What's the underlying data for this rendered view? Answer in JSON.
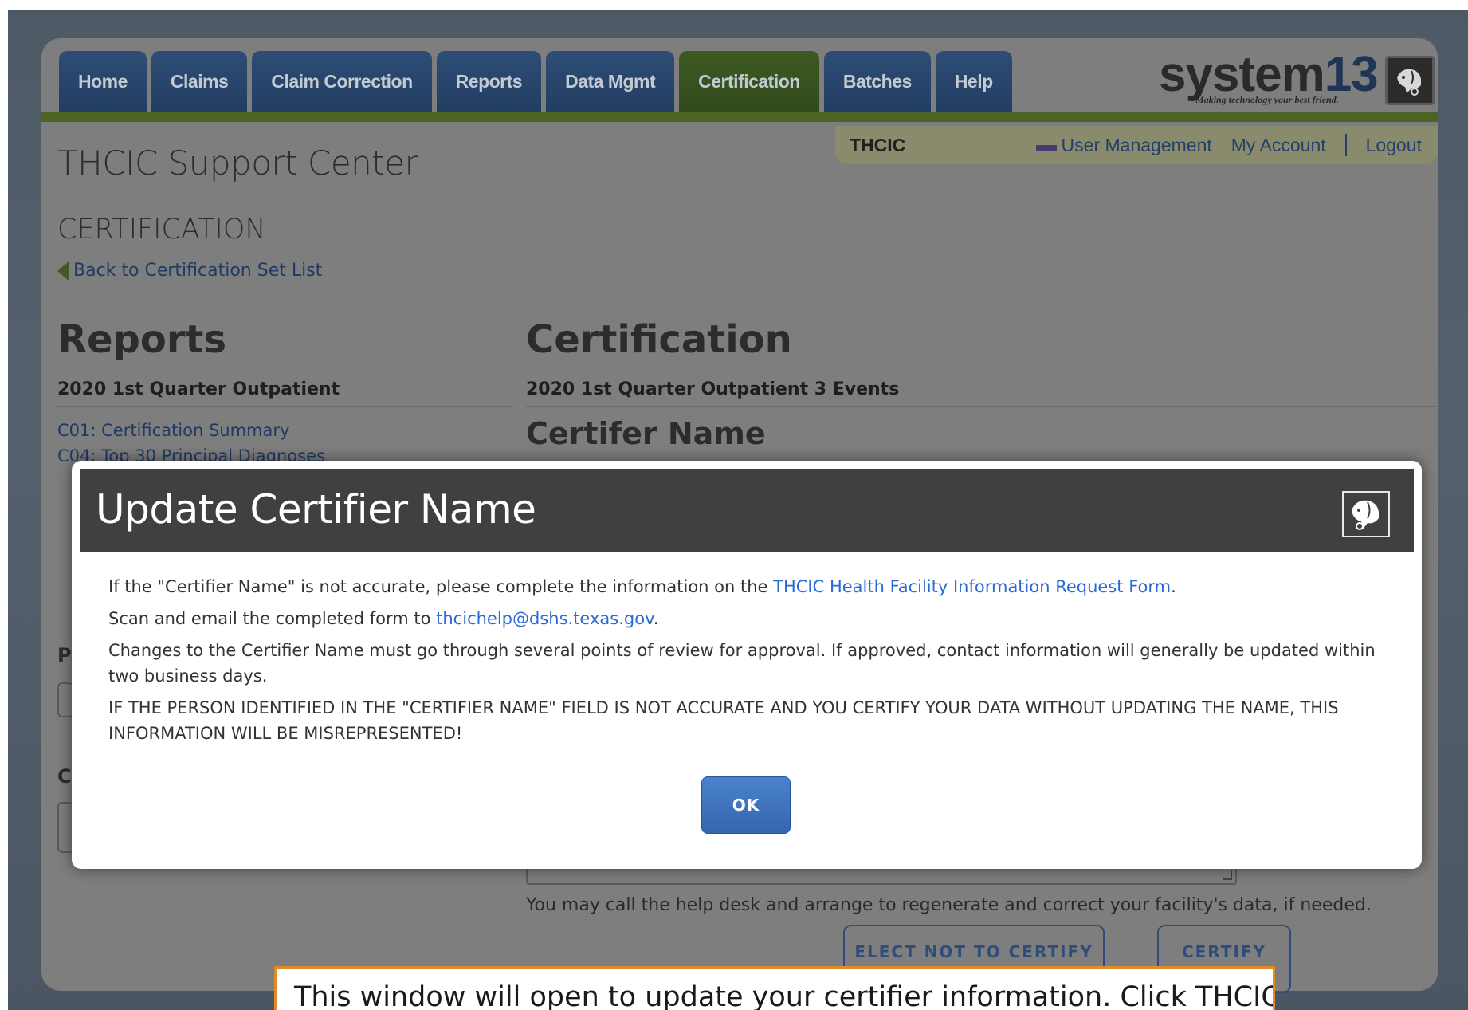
{
  "nav": {
    "tabs": [
      {
        "label": "Home",
        "active": false
      },
      {
        "label": "Claims",
        "active": false
      },
      {
        "label": "Claim Correction",
        "active": false
      },
      {
        "label": "Reports",
        "active": false
      },
      {
        "label": "Data Mgmt",
        "active": false
      },
      {
        "label": "Certification",
        "active": true
      },
      {
        "label": "Batches",
        "active": false
      },
      {
        "label": "Help",
        "active": false
      }
    ]
  },
  "logo": {
    "word": "system",
    "number": "13",
    "tagline": "Making technology your best friend."
  },
  "userbar": {
    "org": "THCIC",
    "user_management": "User Management",
    "my_account": "My Account",
    "logout": "Logout"
  },
  "site_title": "THCIC Support Center",
  "section_title": "CERTIFICATION",
  "back_link": "Back to Certification Set List",
  "reports": {
    "heading": "Reports",
    "subheading": "2020 1st Quarter Outpatient",
    "links": [
      "C01: Certification Summary",
      "C04: Top 30 Principal Diagnoses"
    ]
  },
  "certification": {
    "heading": "Certification",
    "subheading": "2020 1st Quarter Outpatient 3 Events",
    "certifier_heading": "Certifer Name",
    "help_note": "You may call the help desk and arrange to regenerate and correct your facility's data, if needed.",
    "elect_not_button": "ELECT NOT TO CERTIFY",
    "certify_button": "CERTIFY"
  },
  "modal": {
    "title": "Update Certifier Name",
    "p1_before": "If the \"Certifier Name\" is not accurate, please complete the information on the ",
    "p1_link": "THCIC Health Facility Information Request Form",
    "p1_after": ".",
    "p2_before": "Scan and email the completed form to ",
    "p2_link": "thcichelp@dshs.texas.gov",
    "p2_after": ".",
    "p3": "Changes to the Certifier Name must go through several points of review for approval. If approved, contact information will generally be updated within two business days.",
    "p4": "IF THE PERSON IDENTIFIED IN THE \"CERTIFIER NAME\" FIELD IS NOT ACCURATE AND YOU CERTIFY YOUR DATA WITHOUT UPDATING THE NAME, THIS INFORMATION WILL BE MISREPRESENTED!",
    "ok_label": "OK"
  },
  "callout": {
    "text": "This window will open to update your certifier information.  Click THCIC"
  },
  "background_fragments": {
    "c": "C",
    "p": "P"
  },
  "colors": {
    "nav_blue": "#2d4d76",
    "nav_active_green": "#3c5a22",
    "link_blue": "#2a6ad4",
    "ok_blue": "#3566b0",
    "callout_border": "#e08a2a"
  }
}
